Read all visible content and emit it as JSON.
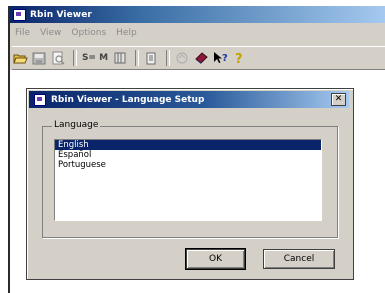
{
  "app": {
    "title": "Rbin Viewer",
    "menu": [
      "File",
      "View",
      "Options",
      "Help"
    ],
    "toolbar_icons": [
      "open-folder-icon",
      "save-icon",
      "print-preview-icon",
      "sort-icon",
      "grid-icon",
      "document-icon",
      "disabled-icon",
      "book-icon",
      "context-help-icon",
      "lightbulb-help-icon"
    ]
  },
  "dialog": {
    "title": "Rbin Viewer - Language Setup",
    "group_label": "Language",
    "languages": [
      "English",
      "Español",
      "Portuguese"
    ],
    "selected_index": 0,
    "ok_label": "OK",
    "cancel_label": "Cancel"
  },
  "colors": {
    "titlebar": "#0a246a",
    "selection": "#0a246a",
    "face": "#d4d0c8"
  }
}
